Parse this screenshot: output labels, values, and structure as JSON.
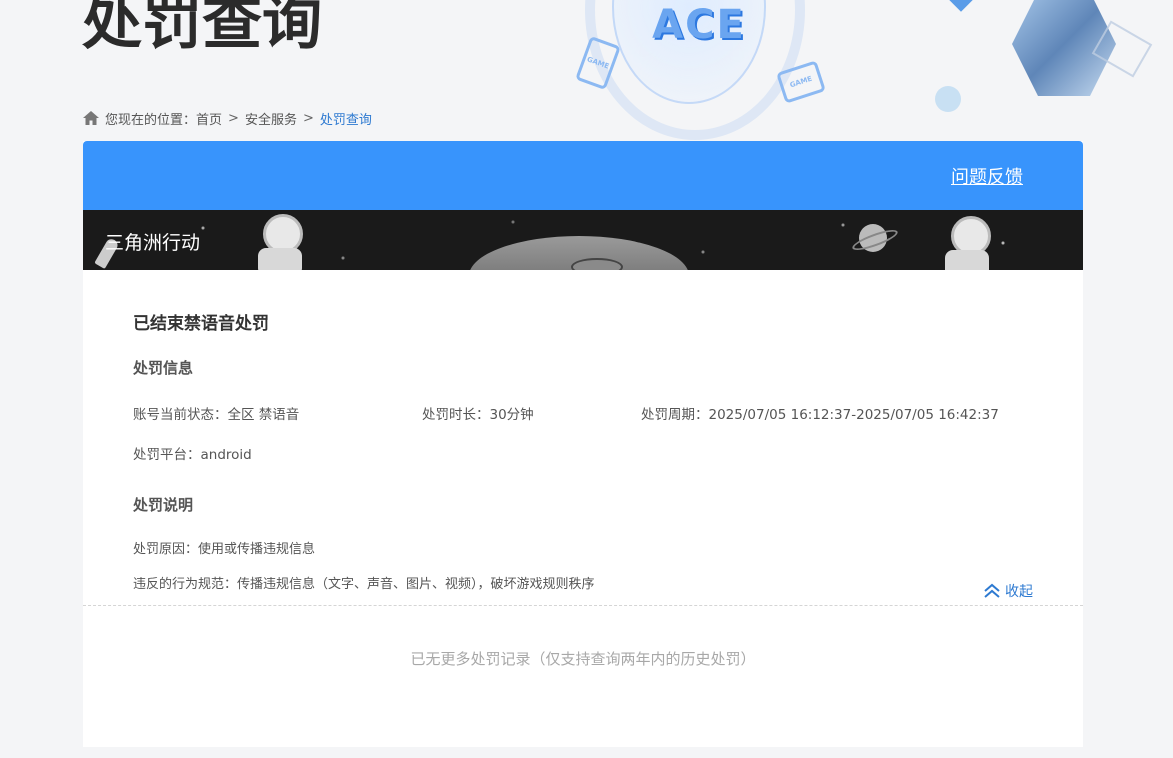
{
  "header": {
    "title": "处罚查询",
    "logo_text": "ACE",
    "chip_text": "GAME"
  },
  "breadcrumb": {
    "prefix": "您现在的位置：",
    "items": [
      "首页",
      "安全服务"
    ],
    "separator": ">",
    "current": "处罚查询"
  },
  "card": {
    "feedback_label": "问题反馈",
    "game_name": "三角洲行动"
  },
  "record": {
    "title": "已结束禁语音处罚",
    "info_section": "处罚信息",
    "account_status": "账号当前状态：全区 禁语音",
    "duration": "处罚时长：30分钟",
    "period": "处罚周期：2025/07/05 16:12:37-2025/07/05 16:42:37",
    "platform": "处罚平台：android",
    "explain_section": "处罚说明",
    "reason": "处罚原因：使用或传播违规信息",
    "violation": "违反的行为规范：传播违规信息（文字、声音、图片、视频），破坏游戏规则秩序",
    "collapse_label": "收起"
  },
  "footer": {
    "no_more_text": "已无更多处罚记录（仅支持查询两年内的历史处罚）"
  },
  "colors": {
    "accent": "#3894fc",
    "link": "#2e7ad1",
    "banner_bg": "#1a1a1a"
  }
}
